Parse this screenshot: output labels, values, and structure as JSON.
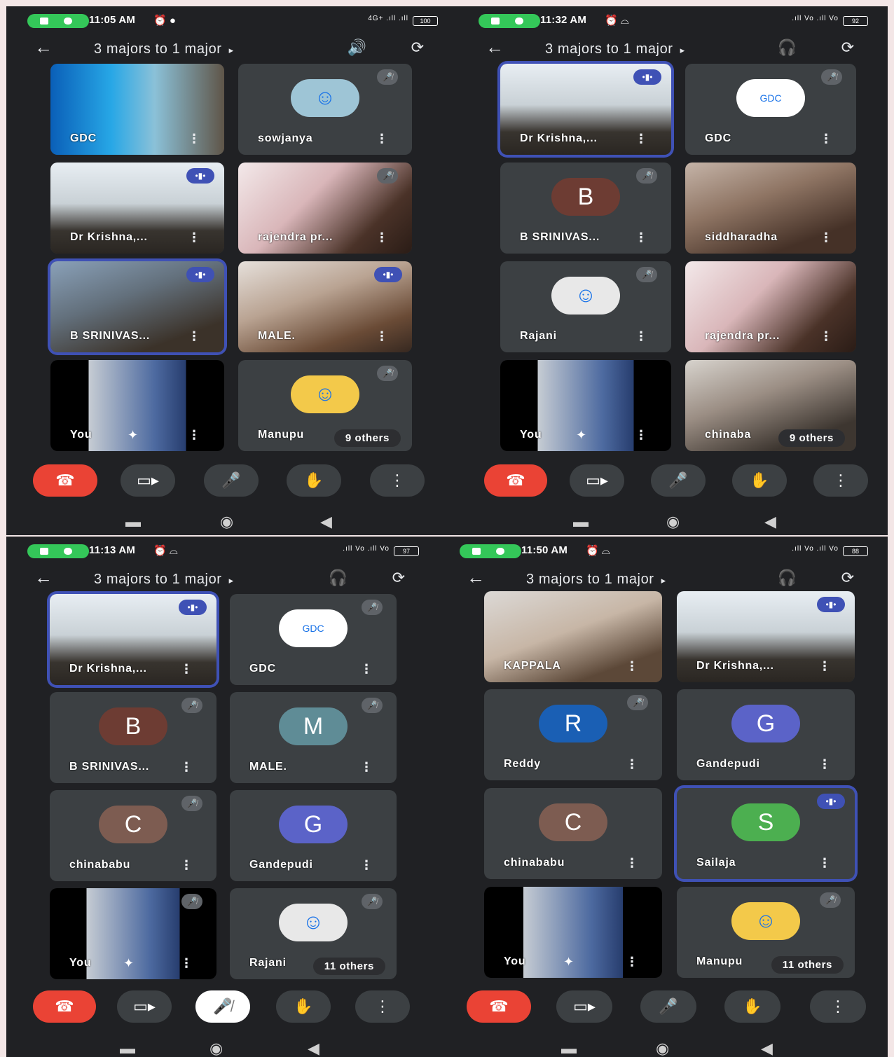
{
  "screens": [
    {
      "status": {
        "time": "11:05 AM",
        "icons": "⏰ ●",
        "signal": "4G+ .ıll .ıll",
        "battery": "100"
      },
      "header": {
        "back_icon": "←",
        "title": "3 majors to 1 major",
        "caret": "▸",
        "icon1": "🔊",
        "icon2": "⟳"
      },
      "tiles": [
        {
          "name": "GDC",
          "style": "v1",
          "state": "none",
          "avatar": "",
          "avatar_color": ""
        },
        {
          "name": "sowjanya",
          "style": "",
          "state": "muted",
          "avatar": "☺",
          "avatar_color": "#9ec5d6"
        },
        {
          "name": "Dr Krishna,...",
          "style": "v2",
          "state": "speaking",
          "avatar": "",
          "avatar_color": ""
        },
        {
          "name": "rajendra pr...",
          "style": "v3",
          "state": "muted",
          "avatar": "",
          "avatar_color": ""
        },
        {
          "name": "B SRINIVAS...",
          "style": "v4",
          "state": "speaking",
          "avatar": "",
          "avatar_color": "",
          "active": true
        },
        {
          "name": "MALE.",
          "style": "v5",
          "state": "speaking",
          "avatar": "",
          "avatar_color": ""
        },
        {
          "name": "You",
          "style": "v6",
          "state": "none",
          "avatar": "",
          "avatar_color": ""
        },
        {
          "name": "Manupu",
          "style": "",
          "state": "muted",
          "avatar": "☺",
          "avatar_color": "#f3c94a",
          "others": "9 others"
        }
      ],
      "controls": [
        "end-call",
        "camera",
        "mic",
        "hand",
        "more"
      ]
    },
    {
      "status": {
        "time": "11:32 AM",
        "icons": "⏰ ⌓",
        "signal": ".ıll Vo .ıll Vo",
        "battery": "92"
      },
      "header": {
        "back_icon": "←",
        "title": "3 majors to 1 major",
        "caret": "▸",
        "icon1": "🎧",
        "icon2": "⟳"
      },
      "tiles": [
        {
          "name": "Dr Krishna,...",
          "style": "v2",
          "state": "speaking",
          "avatar": "",
          "avatar_color": "",
          "active": true
        },
        {
          "name": "GDC",
          "style": "",
          "state": "muted",
          "avatar": "GDC",
          "avatar_color": "#ffffff"
        },
        {
          "name": "B SRINIVAS...",
          "style": "",
          "state": "muted",
          "avatar": "B",
          "avatar_color": "#6d3c33"
        },
        {
          "name": "siddharadha",
          "style": "v7",
          "state": "none",
          "avatar": "",
          "avatar_color": ""
        },
        {
          "name": "Rajani",
          "style": "",
          "state": "muted",
          "avatar": "☺",
          "avatar_color": "#e8e8e8"
        },
        {
          "name": "rajendra pr...",
          "style": "v3",
          "state": "none",
          "avatar": "",
          "avatar_color": ""
        },
        {
          "name": "You",
          "style": "v6",
          "state": "none",
          "avatar": "",
          "avatar_color": ""
        },
        {
          "name": "chinaba",
          "style": "v8",
          "state": "none",
          "avatar": "",
          "avatar_color": "",
          "others": "9 others"
        }
      ],
      "controls": [
        "end-call",
        "camera",
        "mic",
        "hand",
        "more"
      ]
    },
    {
      "status": {
        "time": "11:13 AM",
        "icons": "⏰ ⌓",
        "signal": ".ıll Vo .ıll Vo",
        "battery": "97"
      },
      "header": {
        "back_icon": "←",
        "title": "3 majors to 1 major",
        "caret": "▸",
        "icon1": "🎧",
        "icon2": "⟳"
      },
      "tiles": [
        {
          "name": "Dr Krishna,...",
          "style": "v2",
          "state": "speaking",
          "avatar": "",
          "avatar_color": "",
          "active": true
        },
        {
          "name": "GDC",
          "style": "",
          "state": "muted",
          "avatar": "GDC",
          "avatar_color": "#ffffff"
        },
        {
          "name": "B SRINIVAS...",
          "style": "",
          "state": "muted",
          "avatar": "B",
          "avatar_color": "#6d3c33"
        },
        {
          "name": "MALE.",
          "style": "",
          "state": "muted",
          "avatar": "M",
          "avatar_color": "#5f8c96"
        },
        {
          "name": "chinababu",
          "style": "",
          "state": "muted",
          "avatar": "C",
          "avatar_color": "#7d5c51"
        },
        {
          "name": "Gandepudi",
          "style": "",
          "state": "none",
          "avatar": "G",
          "avatar_color": "#5b63c8"
        },
        {
          "name": "You",
          "style": "v6",
          "state": "muted",
          "avatar": "",
          "avatar_color": ""
        },
        {
          "name": "Rajani",
          "style": "",
          "state": "muted",
          "avatar": "☺",
          "avatar_color": "#e8e8e8",
          "others": "11 others"
        }
      ],
      "controls": [
        "end-call",
        "camera",
        "mic-off",
        "hand",
        "more"
      ]
    },
    {
      "status": {
        "time": "11:50 AM",
        "icons": "⏰ ⌓",
        "signal": ".ıll Vo .ıll Vo",
        "battery": "88"
      },
      "header": {
        "back_icon": "←",
        "title": "3 majors to 1 major",
        "caret": "▸",
        "icon1": "🎧",
        "icon2": "⟳"
      },
      "tiles": [
        {
          "name": "KAPPALA",
          "style": "v9",
          "state": "none",
          "avatar": "",
          "avatar_color": ""
        },
        {
          "name": "Dr Krishna,...",
          "style": "v2",
          "state": "speaking",
          "avatar": "",
          "avatar_color": ""
        },
        {
          "name": "Reddy",
          "style": "",
          "state": "muted",
          "avatar": "R",
          "avatar_color": "#1a5fb4"
        },
        {
          "name": "Gandepudi",
          "style": "",
          "state": "none",
          "avatar": "G",
          "avatar_color": "#5b63c8"
        },
        {
          "name": "chinababu",
          "style": "",
          "state": "none",
          "avatar": "C",
          "avatar_color": "#7d5c51"
        },
        {
          "name": "Sailaja",
          "style": "",
          "state": "speaking",
          "avatar": "S",
          "avatar_color": "#4caf50",
          "active": true
        },
        {
          "name": "You",
          "style": "v6",
          "state": "none",
          "avatar": "",
          "avatar_color": ""
        },
        {
          "name": "Manupu",
          "style": "",
          "state": "muted",
          "avatar": "☺",
          "avatar_color": "#f3c94a",
          "others": "11 others"
        }
      ],
      "controls": [
        "end-call",
        "camera",
        "mic",
        "hand",
        "more"
      ]
    }
  ],
  "control_glyphs": {
    "end-call": "☎",
    "camera": "▭▸",
    "mic": "🎤",
    "mic-off": "🎤̸",
    "hand": "✋",
    "more": "⋮"
  },
  "nav_glyphs": {
    "recents": "▬",
    "home": "◉",
    "back": "◀"
  },
  "tile_glyphs": {
    "more": "⋮",
    "muted": "🎤̸",
    "speaking": "•▮•",
    "sparkle": "✦"
  }
}
